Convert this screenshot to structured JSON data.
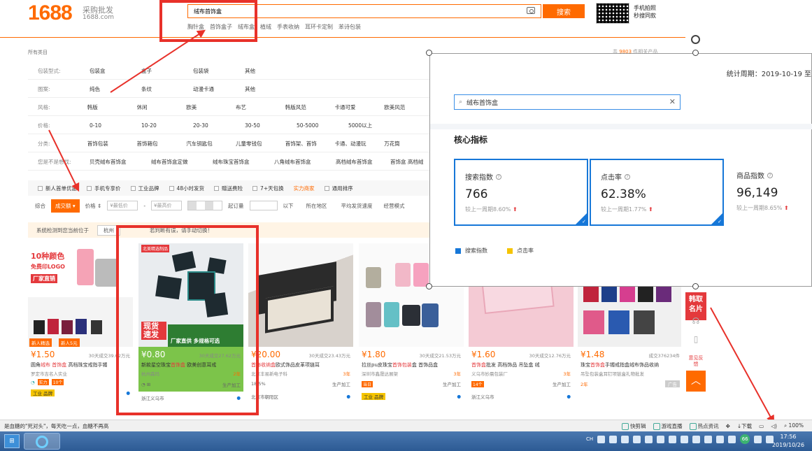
{
  "header": {
    "logo": "1688",
    "logo_sub_cn": "采购批发",
    "logo_sub_url": "1688.com",
    "search_value": "绒布首饰盒",
    "search_button": "搜索",
    "hotwords": [
      "胸针盒",
      "首饰盒子",
      "绒布盒",
      "植绒",
      "手表收纳",
      "耳环卡定制",
      "苯诗包装"
    ],
    "qr_line1": "手机拍照",
    "qr_line2": "秒搜同款"
  },
  "results": {
    "prefix": "共",
    "count": "9803",
    "suffix": "件相关产品"
  },
  "filters": {
    "all_categories": "所有类目",
    "rows": [
      {
        "label": "包装型式:",
        "options": [
          "包装盒",
          "盒子",
          "包装袋",
          "其他"
        ]
      },
      {
        "label": "图案:",
        "options": [
          "纯色",
          "条纹",
          "动漫卡通",
          "其他"
        ]
      },
      {
        "label": "风格:",
        "options": [
          "韩版",
          "休闲",
          "欧美",
          "布艺",
          "韩版风范",
          "卡通可爱",
          "欧美风范"
        ]
      },
      {
        "label": "价格:",
        "options": [
          "0-10",
          "10-20",
          "20-30",
          "30-50",
          "50-5000",
          "5000以上"
        ]
      },
      {
        "label": "分类:",
        "options": [
          "首饰包装",
          "首饰箱包",
          "汽车钥匙包",
          "儿童零钱包",
          "首饰架、首饰",
          "卡通、动漫玩",
          "万花筒"
        ]
      },
      {
        "label": "您是不是想找:",
        "options": [
          "贝壳绒布首饰盒",
          "绒布首饰盒定做",
          "绒布珠宝首饰盒",
          "八角绒布首饰盒",
          "高档绒布首饰盒",
          "首饰盒 高档绒"
        ]
      }
    ],
    "checks": [
      "新人首单优惠",
      "手机专享价",
      "工业品牌",
      "48小时发货",
      "赠送费险",
      "7+天包换",
      "实力商家",
      "通用排序"
    ],
    "sort": {
      "general": "综合",
      "active": "成交额 ▾",
      "price": "价格 ⇕",
      "min_ph": "¥最低价",
      "max_ph": "¥最高价",
      "moq": "起订量",
      "below": "以下",
      "region": "所在地区",
      "ship_speed": "平均发货速度",
      "model": "经营模式"
    }
  },
  "notice": {
    "text": "系统检测到您当前位于",
    "location": "杭州",
    "tail": "若判断有误，请手动切换！"
  },
  "products": [
    {
      "price": "¥1.50",
      "sold": "30天成交39.02万元",
      "title_pre": "圆角",
      "title_hl": "绒布 首饰盒",
      "title_post": " 高档珠宝戒指手镯",
      "company": "罗定市吉名人实业",
      "years": "",
      "loc": "",
      "tag1": "实力",
      "tag2": "10个",
      "img_text1": "10种颜色",
      "img_text2": "免费印LOGO",
      "img_text3": "厂家直销",
      "img_badge1": "新人精选",
      "img_badge2": "新人5元"
    },
    {
      "price": "¥0.80",
      "sold": "30天成交27.62万元",
      "title_pre": "新款星空珠宝",
      "title_hl": "首饰盒",
      "title_post": " 欧美创意耳戒",
      "company": "杭州森玛",
      "years": "2年",
      "loc": "浙江义乌市",
      "tag1": "",
      "tag2": "生产加工",
      "img_text1": "现货速发",
      "img_text2": "厂家直供 多规格可选",
      "img_badge1": "北美精选制品",
      "img_badge2": ""
    },
    {
      "price": "¥20.00",
      "sold": "30天成交23.43万元",
      "title_pre": "",
      "title_hl": "首饰收纳盒",
      "title_post": "欧式饰品皮革项链耳",
      "company": "北京丰易新电子科",
      "years": "3年",
      "loc": "北京市朝阳区",
      "tag1": "18.5%",
      "tag2": "生产加工",
      "img_text1": "",
      "img_text2": "",
      "img_badge1": "",
      "img_badge2": ""
    },
    {
      "price": "¥1.80",
      "sold": "30天成交21.53万元",
      "title_pre": "拉丝pu皮珠宝",
      "title_hl": "首饰包装",
      "title_post": "盒 首饰品盒",
      "company": "深圳市鑫晟达展架",
      "years": "3年",
      "loc": "",
      "tag1": "当日",
      "tag2": "生产加工",
      "img_text1": "",
      "img_text2": "",
      "img_badge1": "",
      "img_badge2": ""
    },
    {
      "price": "¥1.60",
      "sold": "30天成交12.76万元",
      "title_pre": "",
      "title_hl": "首饰盒",
      "title_post": "批发 高档饰品 吊坠盒 绒",
      "company": "义乌市妙晨包装厂",
      "years": "3年",
      "loc": "浙江义乌市",
      "tag1": "14个",
      "tag2": "生产加工",
      "img_text1": "",
      "img_text2": "",
      "img_badge1": "",
      "img_badge2": ""
    },
    {
      "price": "¥1.48",
      "sold": "成交376234件",
      "title_pre": "珠宝",
      "title_hl": "首饰盒",
      "title_post": "手镯戒指盒绒布饰品收纳",
      "company": "吊坠包装盒耳钉项链盒礼物批发",
      "years": "2年",
      "loc": "",
      "tag1": "",
      "tag2": "广告",
      "img_text1": "",
      "img_text2": "",
      "img_badge1": "",
      "img_badge2": ""
    }
  ],
  "panel": {
    "period": "统计周期：2019-10-19 至",
    "search_value": "绒布首饰盒",
    "core_title": "核心指标",
    "metrics": [
      {
        "label": "搜索指数",
        "value": "766",
        "cmp": "较上一周期8.60%",
        "arrow": "⬆"
      },
      {
        "label": "点击率",
        "value": "62.38%",
        "cmp": "较上一周期1.77%",
        "arrow": "⬆"
      },
      {
        "label": "商品指数",
        "value": "96,149",
        "cmp": "较上一周期8.65%",
        "arrow": "⬆"
      }
    ],
    "legend": [
      {
        "label": "搜索指数",
        "color": "#1677d8"
      },
      {
        "label": "点击率",
        "color": "#f5c400"
      }
    ]
  },
  "side": {
    "card_line1": "韩取",
    "card_line2": "名片",
    "feedback": "意见反馈",
    "totop": "︿"
  },
  "statusbar": {
    "left": "是血糖的\"死对头\"，每天吃一点，血糖不再高",
    "items": [
      "快剪辑",
      "游戏直播",
      "热点资讯",
      "下载",
      "100%"
    ]
  },
  "taskbar": {
    "tray_lang": "CH",
    "badge": "66",
    "time": "17:56",
    "date": "2019/10/26"
  },
  "colors": {
    "accent": "#ff6a00",
    "annotation_red": "#e8312a",
    "select_blue": "#1677d8"
  }
}
